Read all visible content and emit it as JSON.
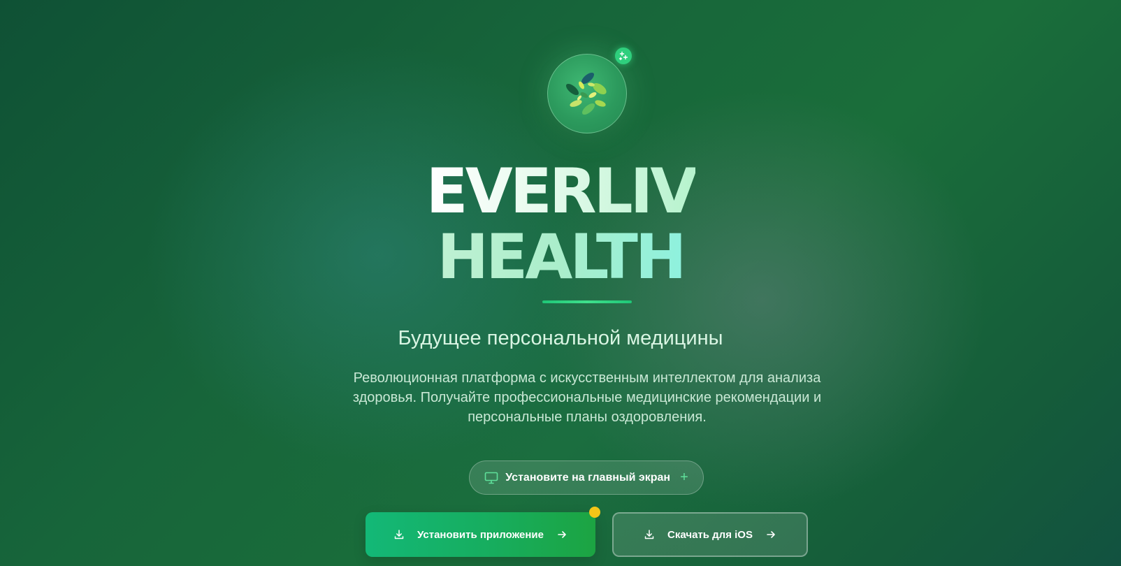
{
  "hero": {
    "title_line1": "EVERLIV",
    "title_line2": "HEALTH",
    "subtitle": "Будущее персональной медицины",
    "description": "Революционная платформа с искусственным интеллектом для анализа здоровья. Получайте профессиональные медицинские рекомендации и персональные планы оздоровления."
  },
  "logo": {
    "icon": "leaves-icon",
    "badge_icon": "sparkle-icon"
  },
  "install_prompt": {
    "label": "Установите на главный экран",
    "icon": "monitor-icon",
    "trailing_icon": "plus-icon",
    "trailing_glyph": "+"
  },
  "actions": {
    "install_label": "Установить приложение",
    "ios_label": "Скачать для iOS",
    "download_icon": "download-icon",
    "arrow_icon": "arrow-right-icon"
  },
  "colors": {
    "background_dark": "#0f5135",
    "background_mid": "#1a6e3a",
    "accent_green": "#1fc777",
    "notification_dot": "#f4c518",
    "install_button_start": "#13b877",
    "install_button_end": "#1ca442"
  }
}
